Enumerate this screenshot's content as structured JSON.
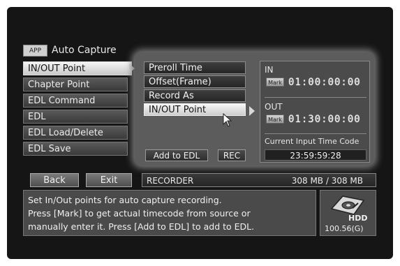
{
  "header": {
    "app_badge": "APP",
    "title": "Auto Capture"
  },
  "left_menu": [
    {
      "label": "IN/OUT Point",
      "selected": true
    },
    {
      "label": "Chapter Point",
      "selected": false
    },
    {
      "label": "EDL Command",
      "selected": false
    },
    {
      "label": "EDL",
      "selected": false
    },
    {
      "label": "EDL Load/Delete",
      "selected": false
    },
    {
      "label": "EDL Save",
      "selected": false
    }
  ],
  "sub_menu": [
    {
      "label": "Preroll Time",
      "selected": false
    },
    {
      "label": "Offset(Frame)",
      "selected": false
    },
    {
      "label": "Record As",
      "selected": false
    },
    {
      "label": "IN/OUT Point",
      "selected": true
    }
  ],
  "actions": {
    "add_to_edl": "Add to EDL",
    "rec": "REC"
  },
  "timecodes": {
    "in_label": "IN",
    "in_mark": "Mark",
    "in_value": "01:00:00:00",
    "out_label": "OUT",
    "out_mark": "Mark",
    "out_value": "01:30:00:00",
    "current_label": "Current Input Time Code",
    "current_value": "23:59:59:28"
  },
  "status_bar": {
    "back": "Back",
    "exit": "Exit",
    "device": "RECORDER",
    "storage": "308 MB  /  308 MB"
  },
  "help_lines": [
    "Set In/Out points for auto capture recording.",
    "Press [Mark] to get actual timecode from source or",
    "manually enter it. Press [Add to EDL] to add to EDL."
  ],
  "hdd": {
    "label": "HDD",
    "capacity": "100.56(G)",
    "icon": "hdd-icon"
  },
  "colors": {
    "background": "#151515",
    "panel": "#5c5c5c",
    "glow": "#7a7a7a",
    "selected": "#e6e6e6"
  }
}
